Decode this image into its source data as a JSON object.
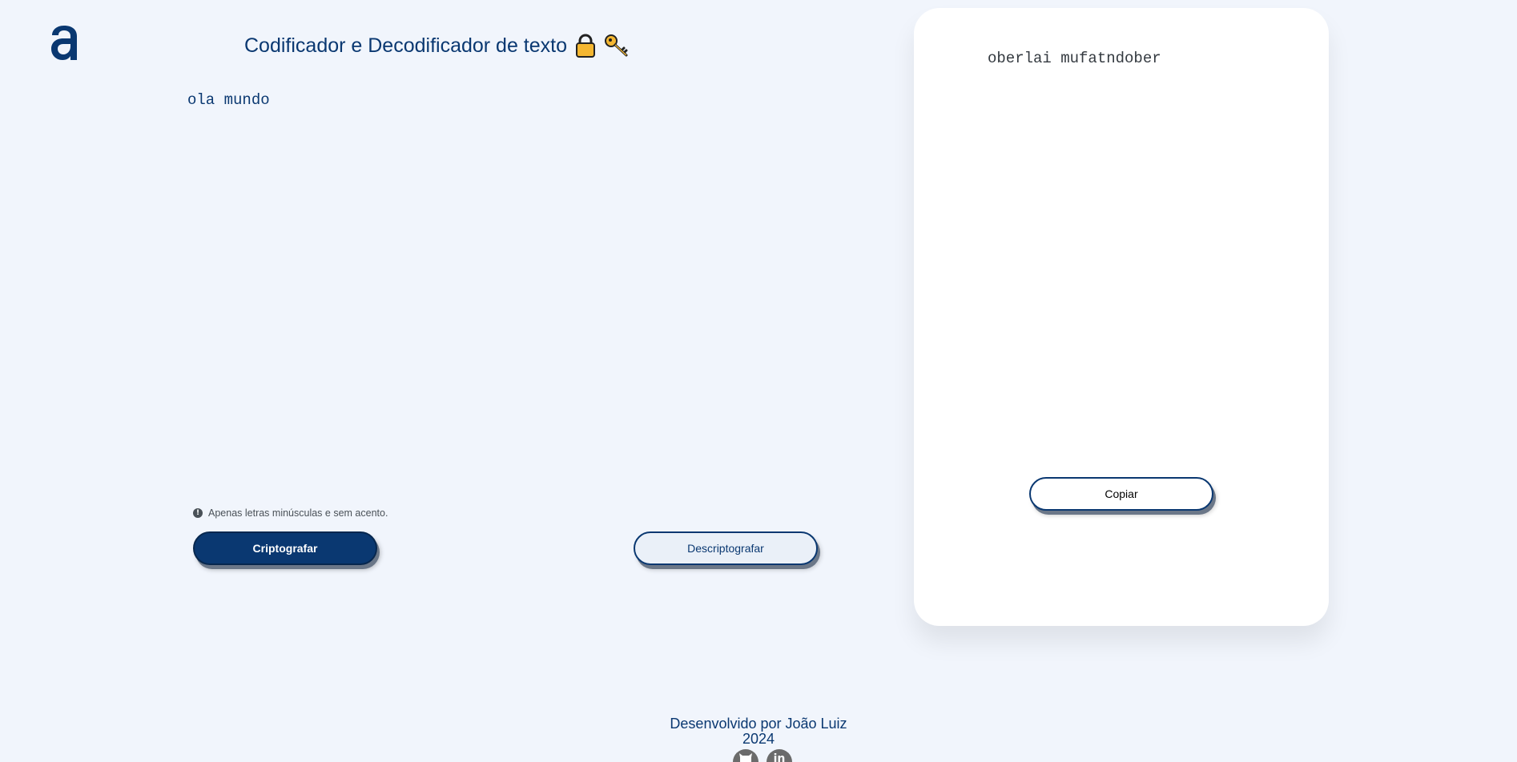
{
  "header": {
    "logo_icon": "alura-a-logo-icon",
    "title": "Codificador e Decodificador de texto",
    "title_icons": [
      "lock-icon",
      "key-icon"
    ]
  },
  "input": {
    "value": "ola mundo"
  },
  "hint": {
    "icon": "info-icon",
    "text": "Apenas letras minúsculas e sem acento."
  },
  "buttons": {
    "encrypt_label": "Criptografar",
    "decrypt_label": "Descriptografar"
  },
  "output": {
    "text": "oberlai mufatndober",
    "copy_label": "Copiar"
  },
  "footer": {
    "credit": "Desenvolvido por João Luiz",
    "year": "2024",
    "social_icons": [
      "github-icon",
      "linkedin-icon"
    ]
  },
  "colors": {
    "background": "#f1f5fc",
    "primary": "#0a3871",
    "card": "#ffffff"
  }
}
